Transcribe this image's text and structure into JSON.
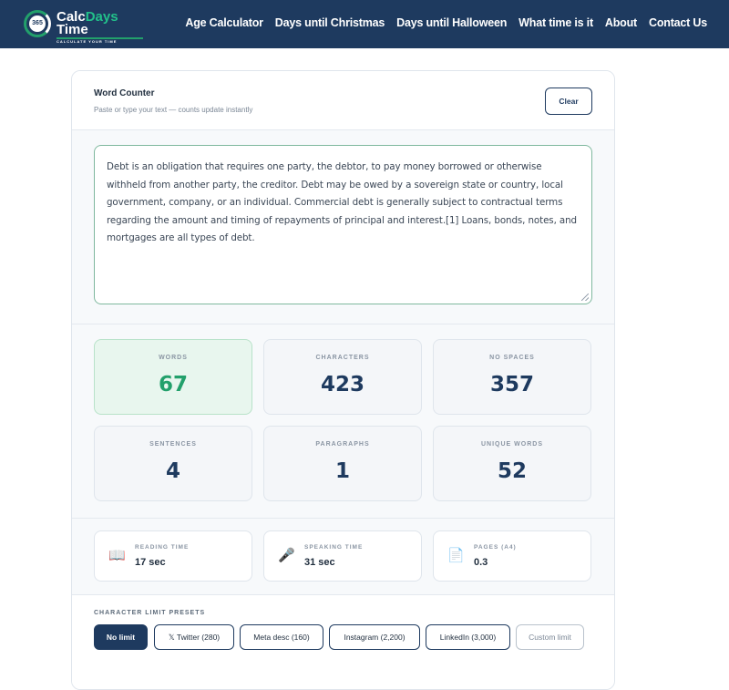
{
  "header": {
    "logo": {
      "badge": "365",
      "line1_main": "Calc",
      "line1_accent": "Days",
      "line2": "Time",
      "tagline": "CALCULATE YOUR TIME"
    },
    "nav": [
      "Age Calculator",
      "Days until Christmas",
      "Days until Halloween",
      "What time is it",
      "About",
      "Contact Us"
    ],
    "colors": {
      "header_bg": "#1e3a5f",
      "accent": "#22a06b"
    }
  },
  "counter": {
    "title": "Word Counter",
    "subtitle": "Paste or type your text — counts update instantly",
    "clear_label": "Clear",
    "text": "Debt is an obligation that requires one party, the debtor, to pay money borrowed or otherwise withheld from another party, the creditor. Debt may be owed by a sovereign state or country, local government, company, or an individual. Commercial debt is generally subject to contractual terms regarding the amount and timing of repayments of principal and interest.[1] Loans, bonds, notes, and mortgages are all types of debt.",
    "stats": [
      {
        "label": "WORDS",
        "value": "67"
      },
      {
        "label": "CHARACTERS",
        "value": "423"
      },
      {
        "label": "NO SPACES",
        "value": "357"
      },
      {
        "label": "SENTENCES",
        "value": "4"
      },
      {
        "label": "PARAGRAPHS",
        "value": "1"
      },
      {
        "label": "UNIQUE WORDS",
        "value": "52"
      }
    ],
    "mini": [
      {
        "label": "READING TIME",
        "value": "17 sec",
        "icon": "book-icon"
      },
      {
        "label": "SPEAKING TIME",
        "value": "31 sec",
        "icon": "microphone-icon"
      },
      {
        "label": "PAGES (A4)",
        "value": "0.3",
        "icon": "page-icon"
      }
    ],
    "presets_title": "CHARACTER LIMIT PRESETS",
    "presets": [
      "No limit",
      "𝕏 Twitter (280)",
      "Meta desc (160)",
      "Instagram (2,200)",
      "LinkedIn (3,000)",
      "Custom limit"
    ]
  }
}
